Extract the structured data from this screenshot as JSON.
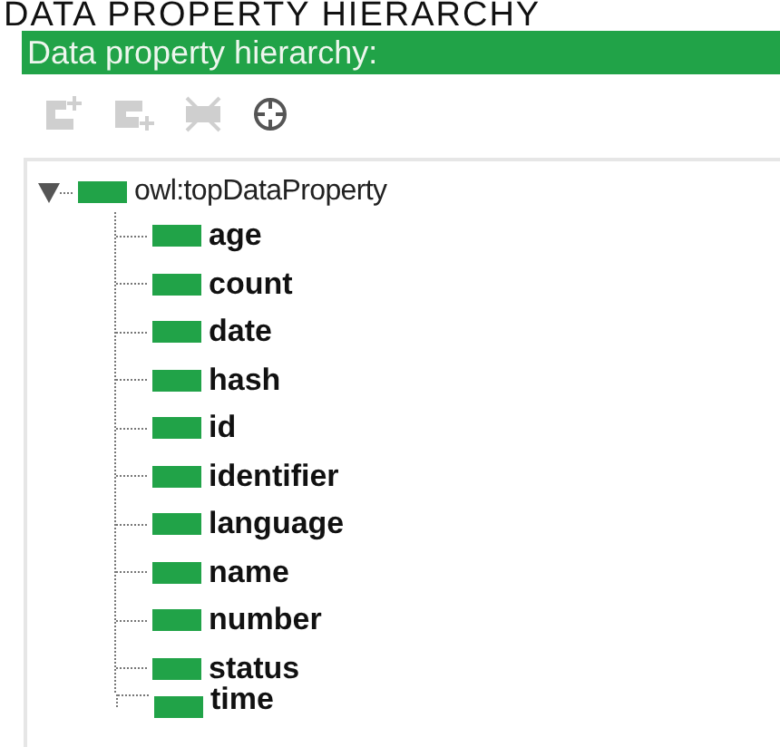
{
  "page_heading": "DATA PROPERTY HIERARCHY",
  "panel": {
    "title": "Data property hierarchy:"
  },
  "toolbar": [
    {
      "kind": "add-sub",
      "disabled": true
    },
    {
      "kind": "add-sibling",
      "disabled": true
    },
    {
      "kind": "delete",
      "disabled": true
    },
    {
      "kind": "find",
      "disabled": false
    }
  ],
  "tree": [
    {
      "label": "owl:topDataProperty",
      "expanded": true,
      "children": [
        {
          "label": "age"
        },
        {
          "label": "count"
        },
        {
          "label": "date"
        },
        {
          "label": "hash"
        },
        {
          "label": "id"
        },
        {
          "label": "identifier"
        },
        {
          "label": "language"
        },
        {
          "label": "name"
        },
        {
          "label": "number"
        },
        {
          "label": "status"
        },
        {
          "label": "time"
        }
      ]
    }
  ]
}
